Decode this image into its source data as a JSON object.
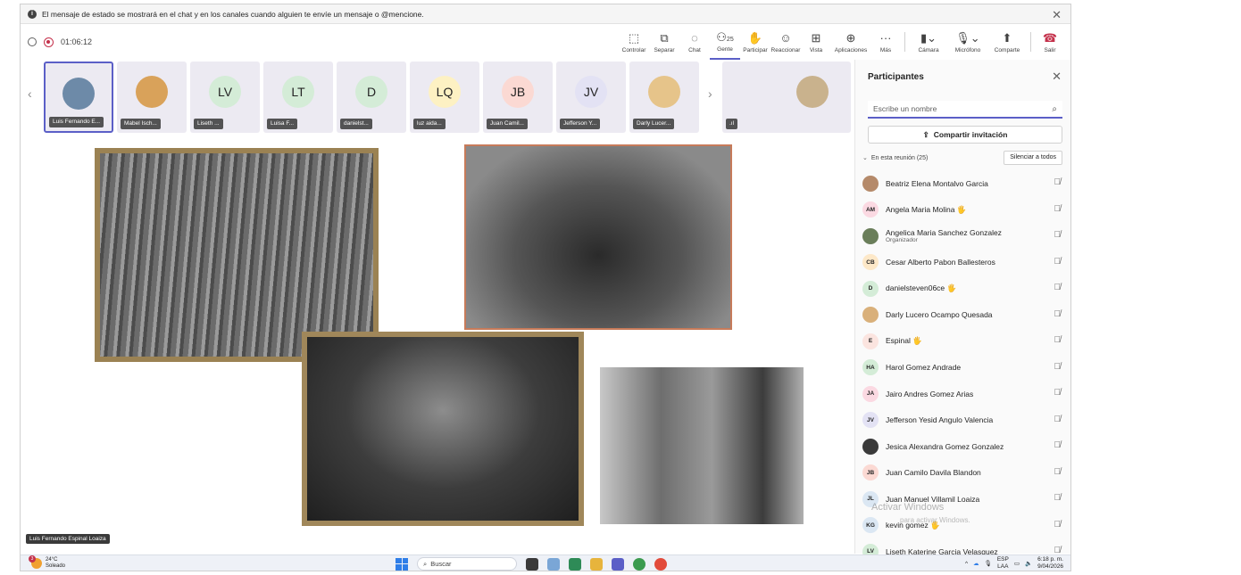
{
  "banner": {
    "message": "El mensaje de estado se mostrará en el chat y en los canales cuando alguien te envíe un mensaje o @mencione."
  },
  "meeting": {
    "timer": "01:06:12"
  },
  "toolbar": {
    "items": [
      {
        "label": "Controlar",
        "icon": "control-icon"
      },
      {
        "label": "Separar",
        "icon": "pop-out-icon"
      },
      {
        "label": "Chat",
        "icon": "chat-icon"
      },
      {
        "label": "Gente",
        "icon": "people-icon",
        "count": "25"
      },
      {
        "label": "Participar",
        "icon": "raise-hand-icon"
      },
      {
        "label": "Reaccionar",
        "icon": "react-icon"
      },
      {
        "label": "Vista",
        "icon": "view-icon"
      },
      {
        "label": "Aplicaciones",
        "icon": "apps-icon"
      },
      {
        "label": "Más",
        "icon": "more-icon"
      },
      {
        "label": "Cámara",
        "icon": "camera-off-icon"
      },
      {
        "label": "Micrófono",
        "icon": "mic-off-icon"
      },
      {
        "label": "Comparte",
        "icon": "share-icon"
      },
      {
        "label": "Salir",
        "icon": "leave-icon"
      }
    ]
  },
  "strip": {
    "tiles": [
      {
        "name": "Luis Fernando E...",
        "initials": "",
        "color": "#6d8aa8"
      },
      {
        "name": "Mabel Isch...",
        "initials": "",
        "color": "#d9a25a"
      },
      {
        "name": "Liseth ...",
        "initials": "LV",
        "color": "#d4ecd7"
      },
      {
        "name": "Luisa F...",
        "initials": "LT",
        "color": "#d4ecd7"
      },
      {
        "name": "danielst...",
        "initials": "D",
        "color": "#d4ecd7"
      },
      {
        "name": "luz aida...",
        "initials": "LQ",
        "color": "#fdf1c3"
      },
      {
        "name": "Juan Camil...",
        "initials": "JB",
        "color": "#fbd9d3"
      },
      {
        "name": "Jefferson Y...",
        "initials": "JV",
        "color": "#e3e2f4"
      },
      {
        "name": "Darly Lucer...",
        "initials": "",
        "color": "#e6c48a"
      }
    ],
    "extra_tile_label": ".ıl"
  },
  "stage": {
    "caption": "Luis Fernando Espinal Loaiza"
  },
  "panel": {
    "title": "Participantes",
    "search_placeholder": "Escribe un nombre",
    "invite_label": "Compartir invitación",
    "section_label": "En esta reunión (25)",
    "mute_all_label": "Silenciar a todos",
    "participants": [
      {
        "name": "Beatriz Elena Montalvo Garcia",
        "initials": "",
        "role": "",
        "color": "#b58a6a"
      },
      {
        "name": "Angela Maria Molina 🖐",
        "initials": "AM",
        "role": "",
        "color": "#fbd9e2"
      },
      {
        "name": "Angelica Maria Sanchez Gonzalez",
        "initials": "",
        "role": "Organizador",
        "color": "#6a7e5a"
      },
      {
        "name": "Cesar Alberto Pabon Ballesteros",
        "initials": "CB",
        "role": "",
        "color": "#fde8c8"
      },
      {
        "name": "danielsteven06ce 🖐",
        "initials": "D",
        "role": "",
        "color": "#d4ecd7"
      },
      {
        "name": "Darly Lucero Ocampo Quesada",
        "initials": "",
        "role": "",
        "color": "#d9b07a"
      },
      {
        "name": "Espinal 🖐",
        "initials": "E",
        "role": "",
        "color": "#fbe4df"
      },
      {
        "name": "Harol Gomez Andrade",
        "initials": "HA",
        "role": "",
        "color": "#d4ecd7"
      },
      {
        "name": "Jairo Andres Gomez Arias",
        "initials": "JA",
        "role": "",
        "color": "#fbd9e2"
      },
      {
        "name": "Jefferson Yesid Angulo Valencia",
        "initials": "JV",
        "role": "",
        "color": "#e3e2f4"
      },
      {
        "name": "Jesica Alexandra Gomez Gonzalez",
        "initials": "",
        "role": "",
        "color": "#3a3a3a"
      },
      {
        "name": "Juan Camilo Davila Blandon",
        "initials": "JB",
        "role": "",
        "color": "#fbd9d3"
      },
      {
        "name": "Juan Manuel Villamil Loaiza",
        "initials": "JL",
        "role": "",
        "color": "#dbe7f3"
      },
      {
        "name": "kevin gomez 🖐",
        "initials": "KG",
        "role": "",
        "color": "#dbe7f3"
      },
      {
        "name": "Liseth Katerine Garcia Velasquez",
        "initials": "LV",
        "role": "",
        "color": "#d4ecd7"
      }
    ],
    "watermark_title": "Activar Windows",
    "watermark_sub": "para activar Windows."
  },
  "taskbar": {
    "weather_temp": "24°C",
    "weather_desc": "Soleado",
    "weather_badge": "3",
    "search_label": "Buscar",
    "lang_top": "ESP",
    "lang_bottom": "LAA",
    "time": "6:18 p. m.",
    "date": "9/04/2026"
  }
}
